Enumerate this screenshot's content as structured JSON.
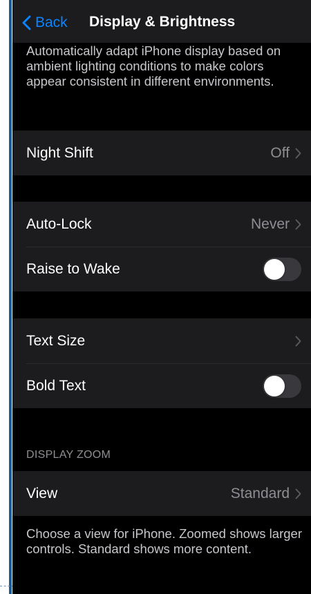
{
  "nav": {
    "back_label": "Back",
    "title": "Display & Brightness"
  },
  "true_tone_footer": "Automatically adapt iPhone display based on ambient lighting conditions to make colors appear consistent in different environments.",
  "groups": {
    "night_shift": {
      "label": "Night Shift",
      "value": "Off"
    },
    "lock": {
      "auto_lock": {
        "label": "Auto-Lock",
        "value": "Never"
      },
      "raise_to_wake": {
        "label": "Raise to Wake",
        "on": false
      }
    },
    "text": {
      "text_size": {
        "label": "Text Size"
      },
      "bold_text": {
        "label": "Bold Text",
        "on": false
      }
    },
    "display_zoom": {
      "header": "DISPLAY ZOOM",
      "view": {
        "label": "View",
        "value": "Standard"
      },
      "footer": "Choose a view for iPhone. Zoomed shows larger controls. Standard shows more content."
    }
  },
  "colors": {
    "accent": "#0a84ff",
    "background": "#000000",
    "cell_background": "#1c1c1e",
    "secondary_text": "#8e8e93",
    "toggle_off": "#39393d"
  },
  "icons": {
    "back": "chevron-left-icon",
    "disclosure": "chevron-right-icon"
  }
}
